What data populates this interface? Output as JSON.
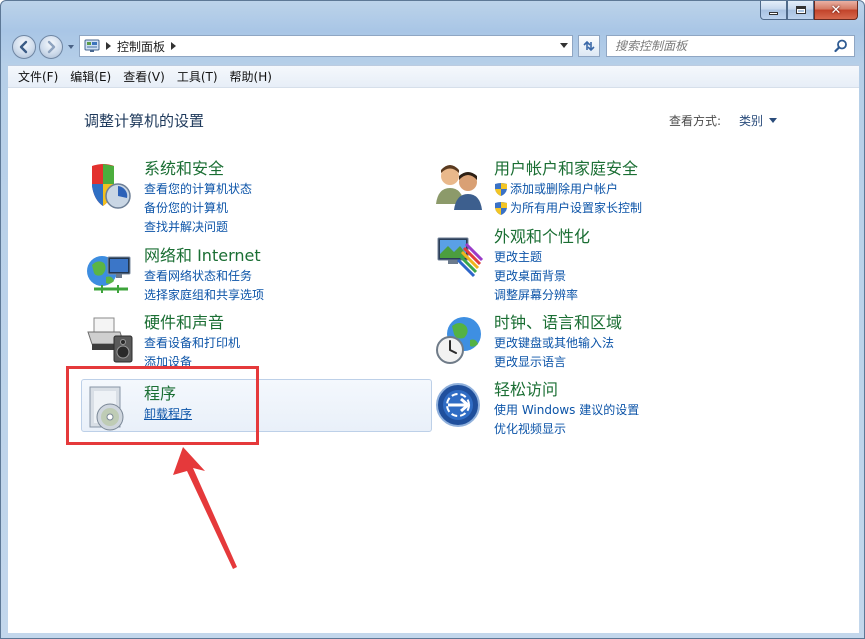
{
  "window": {
    "caption_buttons": [
      "minimize",
      "maximize",
      "close"
    ],
    "close_glyph": "✕"
  },
  "navigation": {
    "address": {
      "icon": "control-panel-icon",
      "path": [
        "控制面板"
      ]
    },
    "search": {
      "placeholder": "搜索控制面板"
    }
  },
  "menubar": {
    "items": [
      "文件(F)",
      "编辑(E)",
      "查看(V)",
      "工具(T)",
      "帮助(H)"
    ]
  },
  "content": {
    "page_title": "调整计算机的设置",
    "view_by": {
      "label": "查看方式:",
      "value": "类别"
    },
    "left": [
      {
        "title": "系统和安全",
        "icon": "shield-check-icon",
        "links": [
          "查看您的计算机状态",
          "备份您的计算机",
          "查找并解决问题"
        ]
      },
      {
        "title": "网络和 Internet",
        "icon": "network-globe-icon",
        "links": [
          "查看网络状态和任务",
          "选择家庭组和共享选项"
        ]
      },
      {
        "title": "硬件和声音",
        "icon": "printer-speaker-icon",
        "links": [
          "查看设备和打印机",
          "添加设备"
        ]
      },
      {
        "title": "程序",
        "icon": "programs-disc-icon",
        "links": [
          "卸载程序"
        ]
      }
    ],
    "right": [
      {
        "title": "用户帐户和家庭安全",
        "icon": "users-icon",
        "links": [
          "添加或删除用户帐户",
          "为所有用户设置家长控制"
        ]
      },
      {
        "title": "外观和个性化",
        "icon": "display-palette-icon",
        "links": [
          "更改主题",
          "更改桌面背景",
          "调整屏幕分辨率"
        ]
      },
      {
        "title": "时钟、语言和区域",
        "icon": "clock-globe-icon",
        "links": [
          "更改键盘或其他输入法",
          "更改显示语言"
        ]
      },
      {
        "title": "轻松访问",
        "icon": "ease-of-access-icon",
        "links": [
          "使用 Windows 建议的设置",
          "优化视频显示"
        ]
      }
    ]
  },
  "colors": {
    "category_title": "#1a6e33",
    "link": "#0c54a8",
    "annotation": "#e5393b",
    "highlight": "#e9f0f9"
  }
}
